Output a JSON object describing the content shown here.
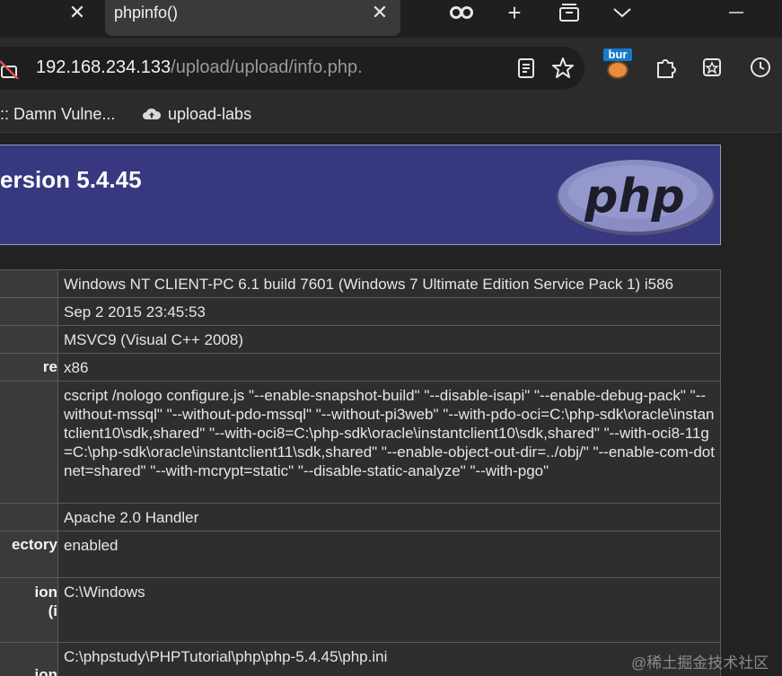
{
  "browser": {
    "tabs": [
      {
        "title": "phpinfo()",
        "active": true
      }
    ],
    "address": {
      "host": "192.168.234.133",
      "path": "/upload/upload/info.php."
    },
    "extension_badge": "bur",
    "bookmarks": [
      {
        "label": ":: Damn Vulne..."
      },
      {
        "label": "upload-labs"
      }
    ],
    "icons": {
      "tab_close": "close-icon",
      "incognito": "incognito-icon",
      "new_tab": "plus-icon",
      "tab_search": "tab-search-icon",
      "tab_list": "chevron-down-icon",
      "minimize": "minimize-icon",
      "insecure": "not-secure-icon",
      "reader": "reader-mode-icon",
      "favorite": "star-icon",
      "extensions": "puzzle-icon",
      "collections": "collections-icon",
      "history": "history-icon"
    }
  },
  "page": {
    "header_title": "ersion 5.4.45",
    "logo_text": "php",
    "rows": [
      {
        "label": "",
        "value": "Windows NT CLIENT-PC 6.1 build 7601 (Windows 7 Ultimate Edition Service Pack 1) i586"
      },
      {
        "label": "",
        "value": "Sep 2 2015 23:45:53"
      },
      {
        "label": "",
        "value": "MSVC9 (Visual C++ 2008)"
      },
      {
        "label": "re",
        "value": "x86"
      },
      {
        "label": "",
        "value": "cscript /nologo configure.js \"--enable-snapshot-build\" \"--disable-isapi\" \"--enable-debug-pack\" \"--without-mssql\" \"--without-pdo-mssql\" \"--without-pi3web\" \"--with-pdo-oci=C:\\php-sdk\\oracle\\instantclient10\\sdk,shared\" \"--with-oci8=C:\\php-sdk\\oracle\\instantclient10\\sdk,shared\" \"--with-oci8-11g=C:\\php-sdk\\oracle\\instantclient11\\sdk,shared\" \"--enable-object-out-dir=../obj/\" \"--enable-com-dotnet=shared\" \"--with-mcrypt=static\" \"--disable-static-analyze\" \"--with-pgo\""
      },
      {
        "label": "",
        "value": "Apache 2.0 Handler"
      },
      {
        "label": "ectory",
        "value": "enabled"
      },
      {
        "label": "ion\ni)",
        "value": "C:\\Windows"
      },
      {
        "label": "ion",
        "value": "C:\\phpstudy\\PHPTutorial\\php\\php-5.4.45\\php.ini"
      }
    ]
  },
  "watermark": "@稀土掘金技术社区"
}
